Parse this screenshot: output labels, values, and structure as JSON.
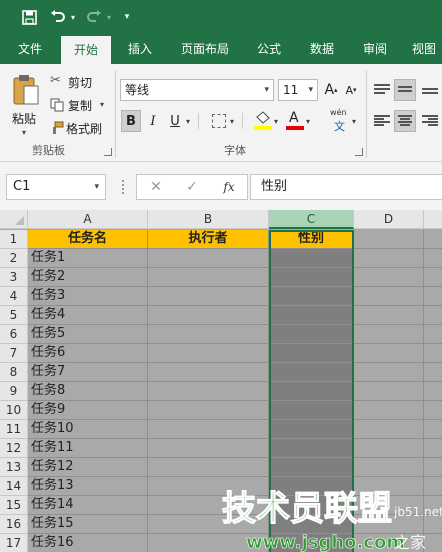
{
  "ribbon_tabs": [
    "文件",
    "开始",
    "插入",
    "页面布局",
    "公式",
    "数据",
    "审阅",
    "视图"
  ],
  "clipboard": {
    "paste_label": "粘贴",
    "cut_label": "剪切",
    "copy_label": "复制",
    "format_painter_label": "格式刷",
    "group_label": "剪贴板"
  },
  "font": {
    "font_name": "等线",
    "font_size": "11",
    "group_label": "字体",
    "bold_label": "B",
    "italic_label": "I",
    "underline_label": "U",
    "grow_label": "A",
    "shrink_label": "A",
    "phonetic_label": "wén",
    "phonetic_sub": "文",
    "font_color": "#e00000",
    "fill_color": "#ffff00"
  },
  "formula_bar": {
    "name_box": "C1",
    "cancel_icon": "✕",
    "enter_icon": "✓",
    "fx_label": "fx",
    "formula": "性别"
  },
  "columns": [
    "A",
    "B",
    "C",
    "D"
  ],
  "selected_column": "C",
  "rows": [
    [
      "任务名",
      "执行者",
      "性别"
    ],
    [
      "任务1",
      "",
      ""
    ],
    [
      "任务2",
      "",
      ""
    ],
    [
      "任务3",
      "",
      ""
    ],
    [
      "任务4",
      "",
      ""
    ],
    [
      "任务5",
      "",
      ""
    ],
    [
      "任务6",
      "",
      ""
    ],
    [
      "任务7",
      "",
      ""
    ],
    [
      "任务8",
      "",
      ""
    ],
    [
      "任务9",
      "",
      ""
    ],
    [
      "任务10",
      "",
      ""
    ],
    [
      "任务11",
      "",
      ""
    ],
    [
      "任务12",
      "",
      ""
    ],
    [
      "任务13",
      "",
      ""
    ],
    [
      "任务14",
      "",
      ""
    ],
    [
      "任务15",
      "",
      ""
    ],
    [
      "任务16",
      "",
      ""
    ]
  ],
  "row_numbers": [
    "1",
    "2",
    "3",
    "4",
    "5",
    "6",
    "7",
    "8",
    "9",
    "10",
    "11",
    "12",
    "13",
    "14",
    "15",
    "16",
    "17"
  ],
  "watermark": {
    "title": "技术员联盟",
    "url": "www.jsgho.com",
    "side": "jb51.net",
    "side2": "之家"
  },
  "colors": {
    "ribbon_green": "#217346",
    "header_fill": "#ffc000",
    "sheet_gray": "#a9a9a9",
    "selected_col_gray": "#7f7f7f"
  }
}
